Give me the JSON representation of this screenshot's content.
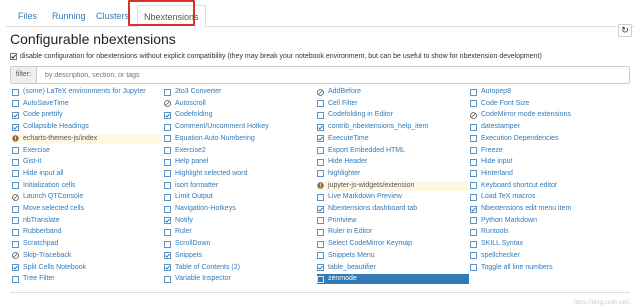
{
  "tabs": [
    {
      "label": "Files",
      "active": false
    },
    {
      "label": "Running",
      "active": false
    },
    {
      "label": "Clusters",
      "active": false
    },
    {
      "label": "Nbextensions",
      "active": true
    }
  ],
  "page_title": "Configurable nbextensions",
  "compat": {
    "checked": true,
    "text": "disable configuration for nbextensions without explicit compatibility (they may break your notebook environment, but can be useful to show for nbextension development)"
  },
  "filter": {
    "label": "filter:",
    "placeholder": "by description, section, or tags"
  },
  "watermark": "https://blog.csdn.net/...",
  "colors": {
    "link": "#337ab7",
    "highlight_red": "#d9322b",
    "warning_bg": "#fcf8e3",
    "selected_bg": "#337ab7"
  },
  "extensions": [
    [
      {
        "label": "(some) LaTeX environments for Jupyter",
        "state": "unchecked"
      },
      {
        "label": "AutoSaveTime",
        "state": "unchecked"
      },
      {
        "label": "Code prettify",
        "state": "checked"
      },
      {
        "label": "Collapsible Headings",
        "state": "checked"
      },
      {
        "label": "echarts-themes-js/index",
        "state": "warning",
        "highlight": "yellow"
      },
      {
        "label": "Exercise",
        "state": "unchecked"
      },
      {
        "label": "Gist-it",
        "state": "unchecked"
      },
      {
        "label": "Hide input all",
        "state": "unchecked"
      },
      {
        "label": "Initialization cells",
        "state": "unchecked"
      },
      {
        "label": "Launch QTConsole",
        "state": "disabled"
      },
      {
        "label": "Move selected cells",
        "state": "unchecked"
      },
      {
        "label": "nbTranslate",
        "state": "unchecked"
      },
      {
        "label": "Rubberband",
        "state": "unchecked"
      },
      {
        "label": "Scratchpad",
        "state": "unchecked"
      },
      {
        "label": "Skip-Traceback",
        "state": "disabled"
      },
      {
        "label": "Split Cells Notebook",
        "state": "checked"
      },
      {
        "label": "Tree Filter",
        "state": "unchecked"
      }
    ],
    [
      {
        "label": "2to3 Converter",
        "state": "unchecked"
      },
      {
        "label": "Autoscroll",
        "state": "disabled"
      },
      {
        "label": "Codefolding",
        "state": "checked"
      },
      {
        "label": "Comment/Uncomment Hotkey",
        "state": "unchecked"
      },
      {
        "label": "Equation Auto Numbering",
        "state": "unchecked"
      },
      {
        "label": "Exercise2",
        "state": "unchecked"
      },
      {
        "label": "Help panel",
        "state": "unchecked"
      },
      {
        "label": "Highlight selected word",
        "state": "unchecked"
      },
      {
        "label": "isort formatter",
        "state": "unchecked"
      },
      {
        "label": "Limit Output",
        "state": "unchecked"
      },
      {
        "label": "Navigation-Hotkeys",
        "state": "unchecked"
      },
      {
        "label": "Notify",
        "state": "checked"
      },
      {
        "label": "Ruler",
        "state": "unchecked"
      },
      {
        "label": "ScrollDown",
        "state": "unchecked"
      },
      {
        "label": "Snippets",
        "state": "checked"
      },
      {
        "label": "Table of Contents (2)",
        "state": "checked"
      },
      {
        "label": "Variable Inspector",
        "state": "unchecked"
      }
    ],
    [
      {
        "label": "AddBefore",
        "state": "disabled"
      },
      {
        "label": "Cell Filter",
        "state": "unchecked"
      },
      {
        "label": "Codefolding in Editor",
        "state": "unchecked"
      },
      {
        "label": "contrib_nbextensions_help_item",
        "state": "checked"
      },
      {
        "label": "ExecuteTime",
        "state": "checked"
      },
      {
        "label": "Export Embedded HTML",
        "state": "unchecked"
      },
      {
        "label": "Hide Header",
        "state": "unchecked"
      },
      {
        "label": "highlighter",
        "state": "unchecked"
      },
      {
        "label": "jupyter-js-widgets/extension",
        "state": "warning",
        "highlight": "yellow"
      },
      {
        "label": "Live Markdown Preview",
        "state": "unchecked"
      },
      {
        "label": "Nbextensions dashboard tab",
        "state": "checked"
      },
      {
        "label": "Printview",
        "state": "unchecked"
      },
      {
        "label": "Ruler in Editor",
        "state": "unchecked"
      },
      {
        "label": "Select CodeMirror Keymap",
        "state": "unchecked"
      },
      {
        "label": "Snippets Menu",
        "state": "unchecked"
      },
      {
        "label": "table_beautifier",
        "state": "checked"
      },
      {
        "label": "zenmode",
        "state": "unchecked",
        "highlight": "blue"
      }
    ],
    [
      {
        "label": "Autopep8",
        "state": "unchecked"
      },
      {
        "label": "Code Font Size",
        "state": "unchecked"
      },
      {
        "label": "CodeMirror mode extensions",
        "state": "disabled"
      },
      {
        "label": "datestamper",
        "state": "unchecked"
      },
      {
        "label": "Execution Dependencies",
        "state": "unchecked"
      },
      {
        "label": "Freeze",
        "state": "unchecked"
      },
      {
        "label": "Hide input",
        "state": "unchecked"
      },
      {
        "label": "Hinterland",
        "state": "unchecked"
      },
      {
        "label": "Keyboard shortcut editor",
        "state": "unchecked"
      },
      {
        "label": "Load TeX macros",
        "state": "unchecked"
      },
      {
        "label": "Nbextensions edit menu item",
        "state": "checked"
      },
      {
        "label": "Python Markdown",
        "state": "unchecked"
      },
      {
        "label": "Runtools",
        "state": "unchecked"
      },
      {
        "label": "SKILL Syntax",
        "state": "unchecked"
      },
      {
        "label": "spellchecker",
        "state": "unchecked"
      },
      {
        "label": "Toggle all line numbers",
        "state": "unchecked"
      },
      {
        "label": "",
        "state": "none"
      }
    ]
  ]
}
